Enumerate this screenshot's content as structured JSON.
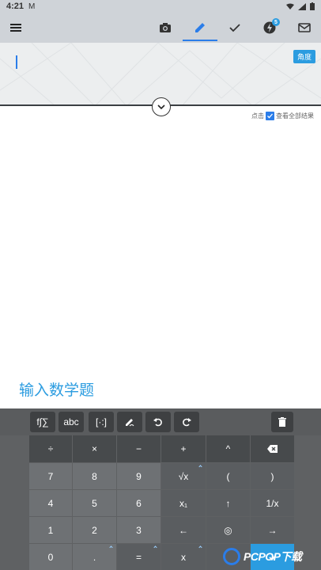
{
  "status_bar": {
    "time": "4:21",
    "mail_glyph": "M"
  },
  "toolbar": {
    "menu_icon": "menu-icon",
    "tabs": [
      {
        "name": "camera-icon",
        "active": false
      },
      {
        "name": "pencil-icon",
        "active": true
      },
      {
        "name": "check-icon",
        "active": false
      },
      {
        "name": "history-icon",
        "active": false
      },
      {
        "name": "mail-icon",
        "active": false
      }
    ],
    "badge_count": "5"
  },
  "input_area": {
    "angle_button": "角度",
    "show_all_prefix": "点击",
    "show_all_label": "查看全部结果"
  },
  "prompt": "输入数学题",
  "keyboard": {
    "top_row": [
      "f∫∑",
      "abc",
      "[·:]"
    ],
    "rows": [
      [
        "÷",
        "×",
        "−",
        "+",
        "^",
        "backspace"
      ],
      [
        "7",
        "8",
        "9",
        "√x",
        "(",
        ")"
      ],
      [
        "4",
        "5",
        "6",
        "x₁",
        "↑",
        "1/x"
      ],
      [
        "1",
        "2",
        "3",
        "←",
        "◎",
        "→"
      ],
      [
        "0",
        ".",
        "=",
        "x",
        "",
        "enter"
      ]
    ]
  },
  "watermark": {
    "text": "PCPOP下载"
  },
  "colors": {
    "accent": "#2b9ce0",
    "primary": "#2b7de9",
    "keyboard_bg": "#5f6163"
  }
}
